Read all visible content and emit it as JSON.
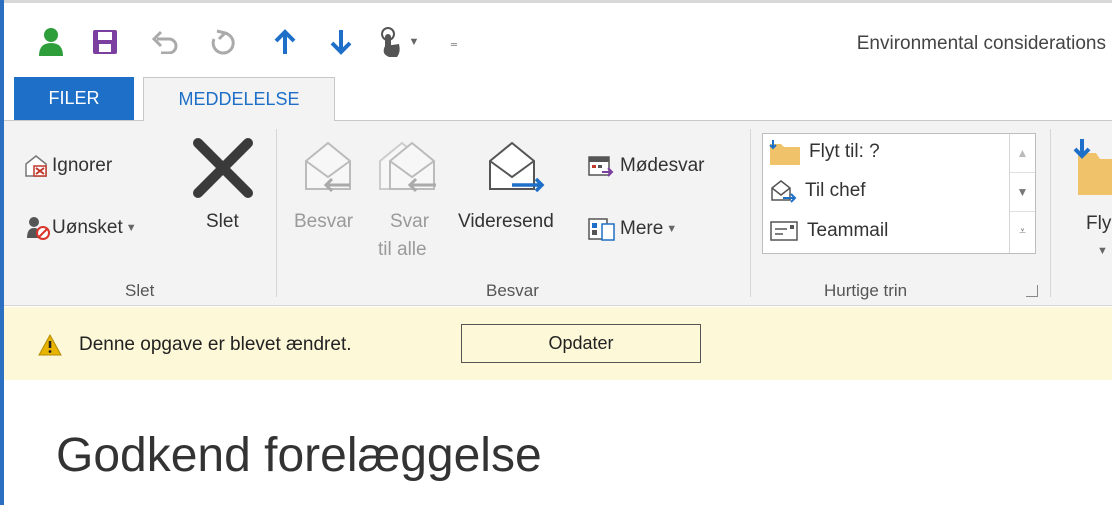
{
  "window": {
    "title": "Environmental considerations"
  },
  "qat": {
    "icons": [
      "person-icon",
      "save-icon",
      "undo-icon",
      "redo-icon",
      "up-arrow-icon",
      "down-arrow-icon",
      "touch-mode-icon",
      "customize-icon"
    ]
  },
  "tabs": [
    {
      "label": "FILER",
      "active": false
    },
    {
      "label": "MEDDELELSE",
      "active": true
    }
  ],
  "ribbon": {
    "slet_group": {
      "ignore_label": "Ignorer",
      "junk_label": "Uønsket",
      "delete_label": "Slet",
      "group_label": "Slet"
    },
    "respond_group": {
      "reply_label": "Besvar",
      "reply_all_line1": "Svar",
      "reply_all_line2": "til alle",
      "forward_label": "Videresend",
      "meeting_label": "Mødesvar",
      "more_label": "Mere",
      "group_label": "Besvar"
    },
    "quick_steps": {
      "items": [
        "Flyt til: ?",
        "Til chef",
        "Teammail"
      ],
      "group_label": "Hurtige trin"
    },
    "move_group": {
      "label": "Fly"
    }
  },
  "infobar": {
    "message": "Denne opgave er blevet ændret.",
    "update_button": "Opdater"
  },
  "content": {
    "heading": "Godkend forelæggelse"
  },
  "colors": {
    "accent": "#1e6fc8",
    "infobar": "#fdf8d8",
    "ribbon": "#f3f3f3"
  }
}
